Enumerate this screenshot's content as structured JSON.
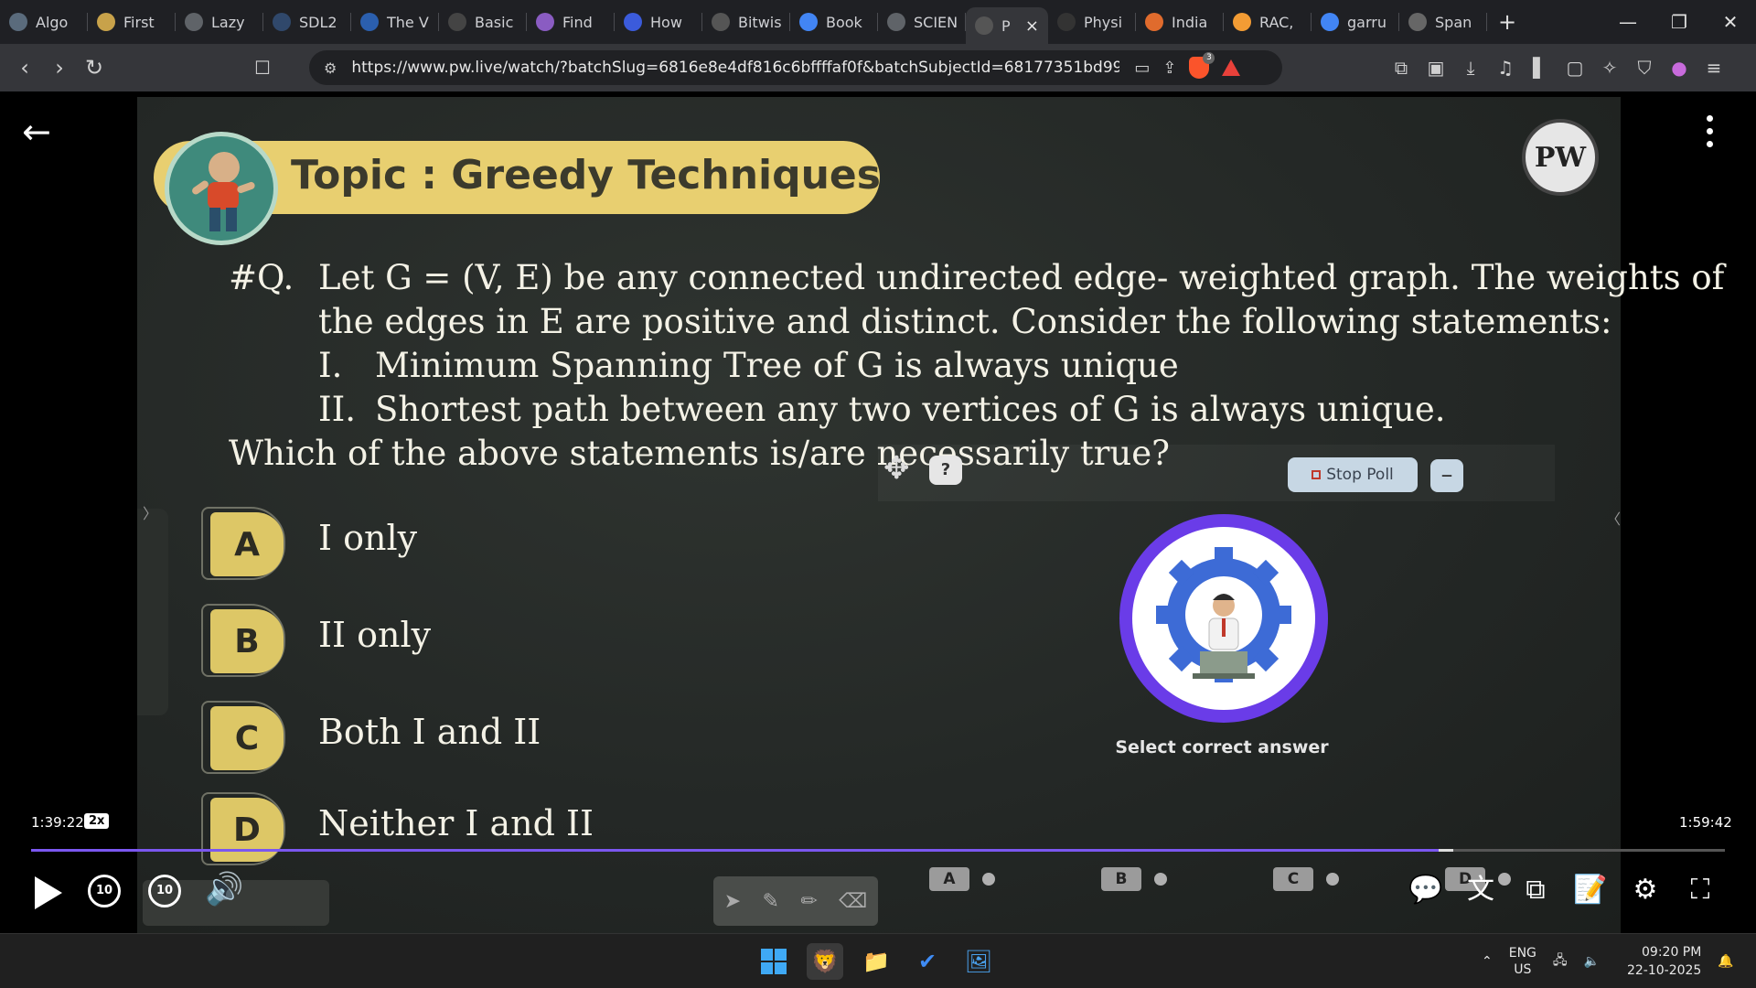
{
  "browser": {
    "tabs": [
      {
        "label": "Algo",
        "icon": "chat-icon",
        "color": "#5a6b7c"
      },
      {
        "label": "First",
        "icon": "lightning-icon",
        "color": "#c8a24a"
      },
      {
        "label": "Lazy",
        "icon": "globe-icon",
        "color": "#5f6368"
      },
      {
        "label": "SDL2",
        "icon": "sdl-icon",
        "color": "#30486b"
      },
      {
        "label": "The V",
        "icon": "wave-icon",
        "color": "#2b5fae"
      },
      {
        "label": "Basic",
        "icon": "gfg-icon",
        "color": "#444"
      },
      {
        "label": "Find",
        "icon": "brain-icon",
        "color": "#8a5cc2"
      },
      {
        "label": "How",
        "icon": "bookmark-icon",
        "color": "#3b5bdb"
      },
      {
        "label": "Bitwis",
        "icon": "geeks-icon",
        "color": "#555"
      },
      {
        "label": "Book",
        "icon": "google-icon",
        "color": "#4285f4"
      },
      {
        "label": "SCIEN",
        "icon": "globe-icon",
        "color": "#5f6368"
      },
      {
        "label": "P",
        "icon": "pw-icon",
        "color": "#555",
        "active": true
      },
      {
        "label": "Physi",
        "icon": "pw-icon",
        "color": "#333"
      },
      {
        "label": "India",
        "icon": "flag-icon",
        "color": "#e06b2d"
      },
      {
        "label": "RAC,",
        "icon": "india-flag-icon",
        "color": "#f39c34"
      },
      {
        "label": "garru",
        "icon": "google-icon",
        "color": "#4285f4"
      },
      {
        "label": "Span",
        "icon": "openai-icon",
        "color": "#666"
      }
    ],
    "new_tab": "+",
    "url": "https://www.pw.live/watch/?batchSlug=6816e8e4df816c6bffffaf0f&batchSubjectId=68177351bd99cdec83a...",
    "shield_count": "3"
  },
  "lecture": {
    "topic": "Topic : Greedy Techniques",
    "logo_text": "PW",
    "question": {
      "label": "#Q.",
      "line1": "Let G = (V, E) be any connected undirected edge- weighted graph. The weights of",
      "line2": "the edges in E are positive and distinct. Consider the following statements:",
      "stmt1_num": "I.",
      "stmt1": "Minimum Spanning Tree of G is always unique",
      "stmt2_num": "II.",
      "stmt2": "Shortest path between any two vertices of G is always unique.",
      "ask": "Which of the above statements is/are necessarily true?"
    },
    "options": [
      {
        "key": "A",
        "text": "I only"
      },
      {
        "key": "B",
        "text": "II only"
      },
      {
        "key": "C",
        "text": "Both I and II"
      },
      {
        "key": "D",
        "text": "Neither I and II"
      }
    ]
  },
  "poll": {
    "help": "?",
    "stop_label": "Stop Poll",
    "minimize": "–",
    "prompt": "Select correct answer",
    "answer_keys": [
      "A",
      "B",
      "C",
      "D"
    ]
  },
  "player": {
    "current_time": "1:39:22",
    "speed": "2x",
    "duration": "1:59:42",
    "progress_fraction": 0.831,
    "skip_back": "10",
    "skip_forward": "10",
    "accent": "#7b57f0"
  },
  "taskbar": {
    "lang_top": "ENG",
    "lang_bottom": "US",
    "time": "09:20 PM",
    "date": "22-10-2025"
  }
}
